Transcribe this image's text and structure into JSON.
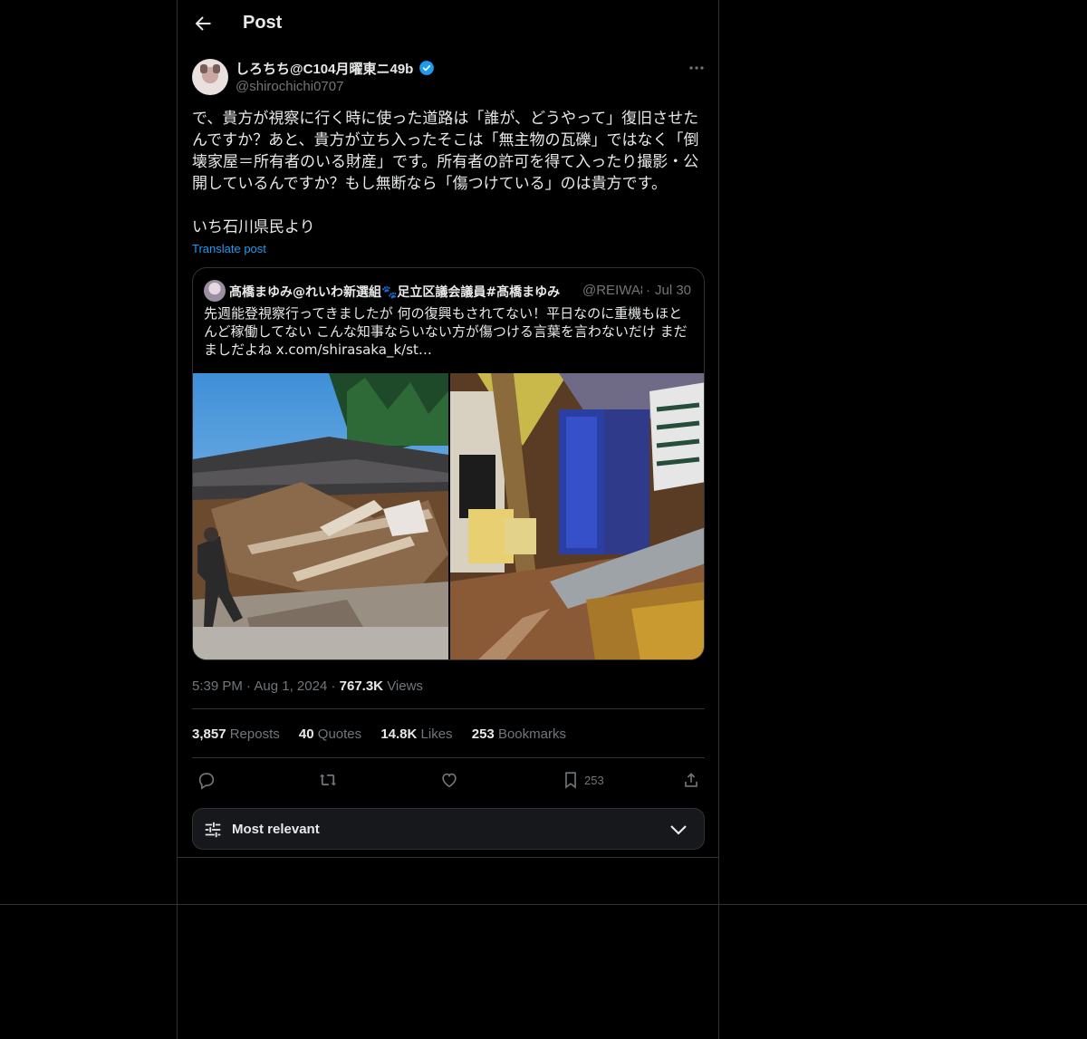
{
  "header": {
    "title": "Post"
  },
  "post": {
    "author_name": "しろちち@C104月曜東ニ49b",
    "handle": "@shirochichi0707",
    "body": "で、貴方が視察に行く時に使った道路は「誰が、どうやって」復旧させたんですか？あと、貴方が立ち入ったそこは「無主物の瓦礫」ではなく「倒壊家屋＝所有者のいる財産」です。所有者の許可を得て入ったり撮影・公開しているんですか？もし無断なら「傷つけている」のは貴方です。\n\nいち石川県民より",
    "translate_label": "Translate post"
  },
  "quote": {
    "author_name": "髙橋まゆみ@れいわ新選組🐾足立区議会議員#髙橋まゆみ",
    "handle": "@REIWA8",
    "dot": "·",
    "date": "Jul 30",
    "text": "先週能登視察行ってきましたが 何の復興もされてない！平日なのに重機もほとんど稼働してない  こんな知事ならいない方が傷つける言葉を言わないだけ まだましだよね  x.com/shirasaka_k/st…"
  },
  "meta": {
    "time": "5:39 PM",
    "dot1": "·",
    "date": "Aug 1, 2024",
    "dot2": "·",
    "views_count": "767.3K",
    "views_label": "Views"
  },
  "stats": {
    "reposts_count": "3,857",
    "reposts_label": "Reposts",
    "quotes_count": "40",
    "quotes_label": "Quotes",
    "likes_count": "14.8K",
    "likes_label": "Likes",
    "bookmarks_count": "253",
    "bookmarks_label": "Bookmarks"
  },
  "actions": {
    "bookmark_count": "253"
  },
  "sort": {
    "label": "Most relevant"
  },
  "colors": {
    "accent": "#1d9bf0",
    "background": "#000000",
    "border": "#2f3336",
    "muted": "#71767b"
  }
}
